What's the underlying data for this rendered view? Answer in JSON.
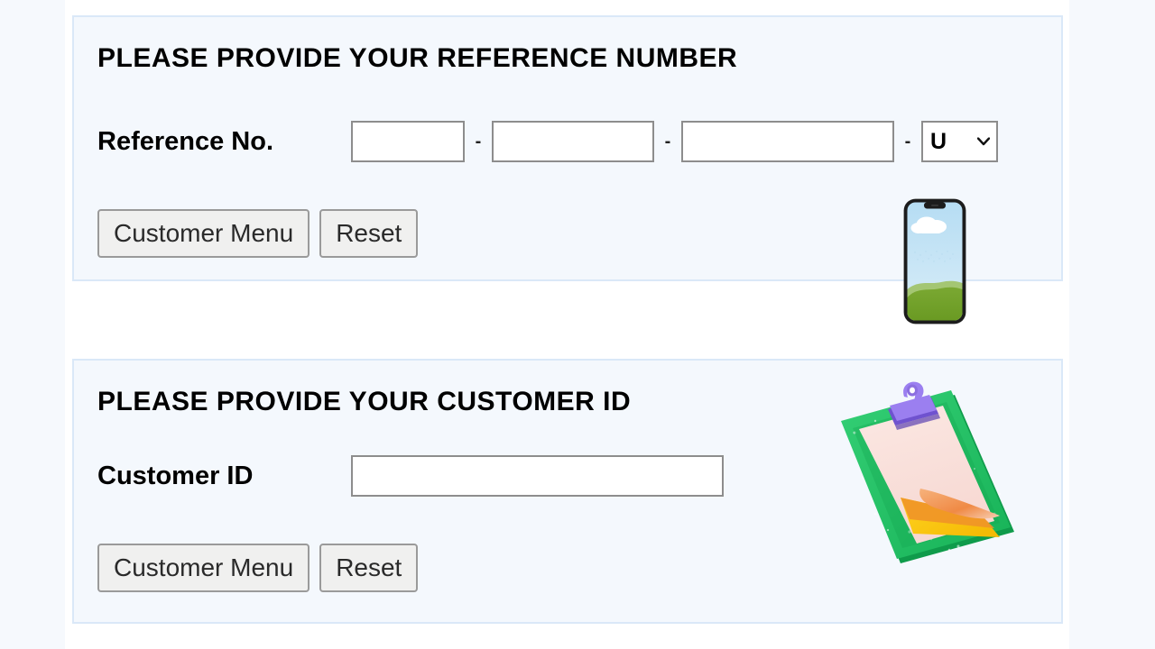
{
  "page": {
    "background_color": "#f6f9fd",
    "surface_color": "#ffffff"
  },
  "reference_panel": {
    "heading": "PLEASE PROVIDE YOUR REFERENCE NUMBER",
    "label": "Reference No.",
    "border_color": "#dae8f8",
    "fill_color": "#f4f8fd",
    "inputs": [
      {
        "name": "reference-part-1",
        "value": "",
        "placeholder": ""
      },
      {
        "name": "reference-part-2",
        "value": "",
        "placeholder": ""
      },
      {
        "name": "reference-part-3",
        "value": "",
        "placeholder": ""
      }
    ],
    "separator": "-",
    "suffix_select": {
      "selected": "U",
      "options": [
        "U"
      ],
      "icon": "chevron-down-icon"
    },
    "buttons": {
      "primary": "Customer Menu",
      "secondary": "Reset"
    },
    "illustration": {
      "name": "smartphone-illustration",
      "frame_color": "#1c1c1c",
      "sky_color": "#bfe0f5",
      "cloud_color": "#ffffff",
      "hill_color": "#6f9e2e",
      "hill_highlight_color": "#8fb94a"
    }
  },
  "customer_panel": {
    "heading": "PLEASE PROVIDE YOUR CUSTOMER ID",
    "label": "Customer ID",
    "border_color": "#dae8f8",
    "fill_color": "#f4f8fd",
    "input": {
      "name": "customer-id",
      "value": "",
      "placeholder": ""
    },
    "buttons": {
      "primary": "Customer Menu",
      "secondary": "Reset"
    },
    "illustration": {
      "name": "clipboard-illustration",
      "board_color": "#2fc36a",
      "board_shadow_color": "#13a550",
      "clip_color": "#8c6fe0",
      "paper_color": "#f9e0dd",
      "paper_curl_color": "#f3a06a",
      "under_paper_color": "#f5c518"
    }
  }
}
